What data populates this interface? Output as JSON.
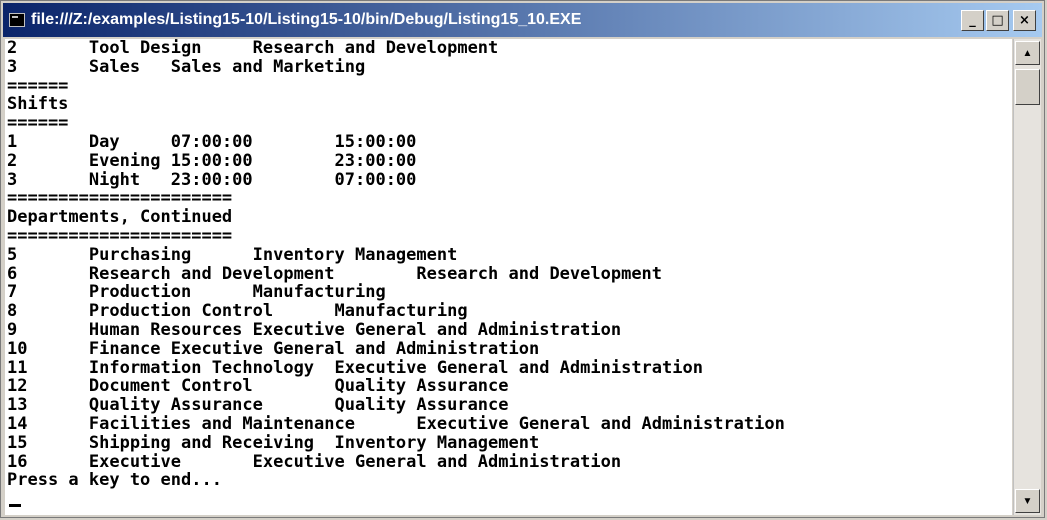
{
  "window": {
    "title": "file:///Z:/examples/Listing15-10/Listing15-10/bin/Debug/Listing15_10.EXE",
    "minimize_glyph": "_",
    "maximize_glyph": "□",
    "close_glyph": "×"
  },
  "console": {
    "lines": [
      "2       Tool Design     Research and Development",
      "3       Sales   Sales and Marketing",
      "======",
      "Shifts",
      "======",
      "1       Day     07:00:00        15:00:00",
      "2       Evening 15:00:00        23:00:00",
      "3       Night   23:00:00        07:00:00",
      "======================",
      "Departments, Continued",
      "======================",
      "5       Purchasing      Inventory Management",
      "6       Research and Development        Research and Development",
      "7       Production      Manufacturing",
      "8       Production Control      Manufacturing",
      "9       Human Resources Executive General and Administration",
      "10      Finance Executive General and Administration",
      "11      Information Technology  Executive General and Administration",
      "12      Document Control        Quality Assurance",
      "13      Quality Assurance       Quality Assurance",
      "14      Facilities and Maintenance      Executive General and Administration",
      "15      Shipping and Receiving  Inventory Management",
      "16      Executive       Executive General and Administration",
      "Press a key to end..."
    ]
  },
  "scrollbar": {
    "up_glyph": "▲",
    "down_glyph": "▼"
  },
  "colors": {
    "titlebar_start": "#0a246a",
    "titlebar_end": "#a6caf0",
    "console_bg": "#ffffff",
    "console_text": "#000000"
  }
}
